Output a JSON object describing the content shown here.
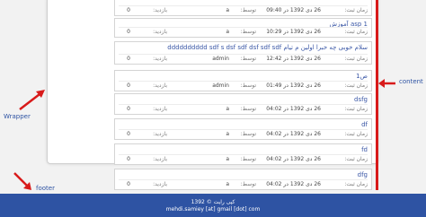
{
  "labels": {
    "date": "زمان ثبت:",
    "author": "توسط:",
    "views": "بازدید:"
  },
  "posts": [
    {
      "title": "",
      "date": "26 دی 1392 در 09:40",
      "author": "a",
      "views": "0"
    },
    {
      "title": "asp 1 آموزش",
      "date": "26 دی 1392 در 10:29",
      "author": "a",
      "views": "0"
    },
    {
      "title": "سلام خوبی چه خبرا اولین م تیام dddddddddd sdf s dsf sdf dsf sdf sdf",
      "date": "26 دی 1392 در 12:42",
      "author": "admin",
      "views": "0"
    },
    {
      "title": "ص1",
      "date": "26 دی 1392 در 01:49",
      "author": "admin",
      "views": "0"
    },
    {
      "title": "dsfg",
      "date": "26 دی 1392 در 04:02",
      "author": "a",
      "views": "0"
    },
    {
      "title": "df",
      "date": "26 دی 1392 در 04:02",
      "author": "a",
      "views": "0"
    },
    {
      "title": "fd",
      "date": "26 دی 1392 در 04:02",
      "author": "a",
      "views": "0"
    },
    {
      "title": "dfg",
      "date": "26 دی 1392 در 04:02",
      "author": "a",
      "views": "0"
    }
  ],
  "annotations": {
    "wrapper": "Wrapper",
    "content": "content",
    "footer": "footer"
  },
  "footer": {
    "line1": "کپی رایت © 1392",
    "line2": "mehdi.samiey [at] gmail [dot] com"
  },
  "colors": {
    "accent": "#2e53a3",
    "annotation": "#d81a1a"
  }
}
